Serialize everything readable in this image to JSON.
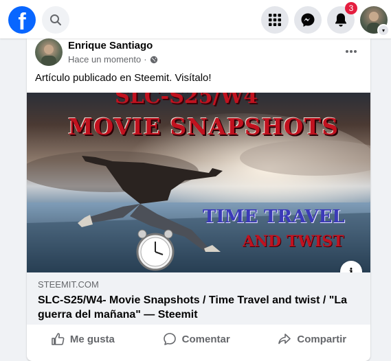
{
  "topbar": {
    "logo_letter": "f",
    "icons": {
      "logo": "facebook-logo",
      "search": "search-icon",
      "menu": "menu-grid-icon",
      "messenger": "messenger-icon",
      "notifications": "bell-icon",
      "profile": "profile-avatar",
      "profile_chevron": "chevron-down-icon"
    },
    "notification_count": "3"
  },
  "post": {
    "author": "Enrique Santiago",
    "time": "Hace un momento",
    "separator": "·",
    "audience_icon": "globe-icon",
    "more_icon": "more-horizontal-icon",
    "text": "Artículo publicado en Steemit. Visítalo!"
  },
  "link": {
    "image": {
      "title_line_1": "SLC-S25/W4",
      "title_line_2": "MOVIE SNAPSHOTS",
      "subtitle_line_1": "TIME TRAVEL",
      "subtitle_line_2": "AND TWIST"
    },
    "info_label": "i",
    "domain": "STEEMIT.COM",
    "title": "SLC-S25/W4- Movie Snapshots / Time Travel and twist / \"La guerra del mañana\" — Steemit"
  },
  "actions": {
    "like": "Me gusta",
    "comment": "Comentar",
    "share": "Compartir"
  },
  "colors": {
    "brand_blue": "#0866ff",
    "badge_red": "#e41e3f",
    "secondary_text": "#65676b"
  }
}
